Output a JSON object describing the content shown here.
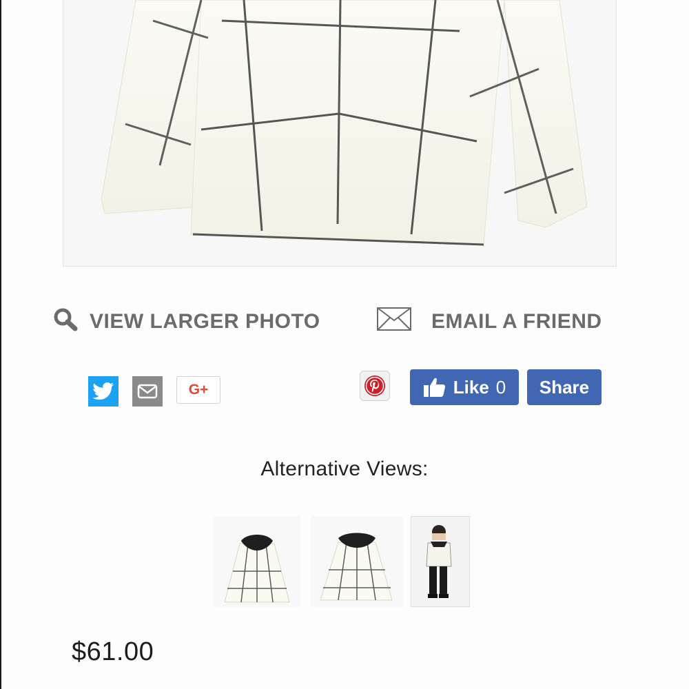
{
  "product": {
    "main_photo": "white-grid-pattern-top-photo",
    "price": "$61.00"
  },
  "actions": {
    "view_larger_label": "VIEW LARGER PHOTO",
    "email_friend_label": "EMAIL A FRIEND"
  },
  "share": {
    "twitter_icon": "twitter-icon",
    "email_icon": "email-icon",
    "gplus_label": "G+",
    "pinterest_icon": "pinterest-icon",
    "like_label": "Like",
    "like_count": "0",
    "share_label": "Share"
  },
  "alternative_views": {
    "title": "Alternative Views:",
    "thumbnails": [
      "top-front-view",
      "top-back-view",
      "model-wearing-view"
    ]
  },
  "colors": {
    "facebook": "#4267b2",
    "twitter": "#1da1f2",
    "pinterest": "#cb2027",
    "action_text": "#6b6b6b"
  }
}
